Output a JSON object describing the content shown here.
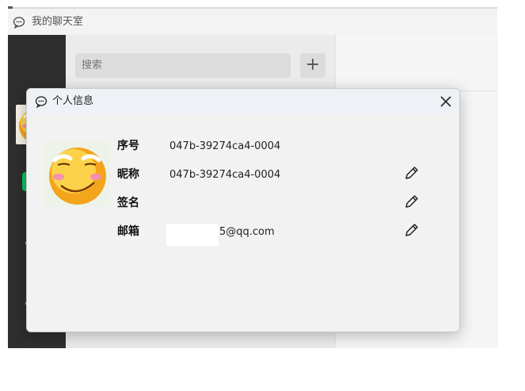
{
  "app": {
    "title": "我的聊天室"
  },
  "search": {
    "placeholder": "搜索"
  },
  "toolbar": {
    "add_label": "+"
  },
  "dialog": {
    "title": "个人信息",
    "fields": [
      {
        "label": "序号",
        "value": "047b-39274ca4-0004"
      },
      {
        "label": "昵称",
        "value": "047b-39274ca4-0004"
      },
      {
        "label": "签名",
        "value": ""
      },
      {
        "label": "邮箱",
        "value": "5@qq.com"
      }
    ]
  },
  "colors": {
    "rail": "#2e2e2e",
    "accent": "#07c160",
    "dialog_bg": "#f2f2f2"
  },
  "icons": [
    "chat-bubble-icon",
    "close-icon",
    "pencil-icon",
    "avatar-face"
  ]
}
